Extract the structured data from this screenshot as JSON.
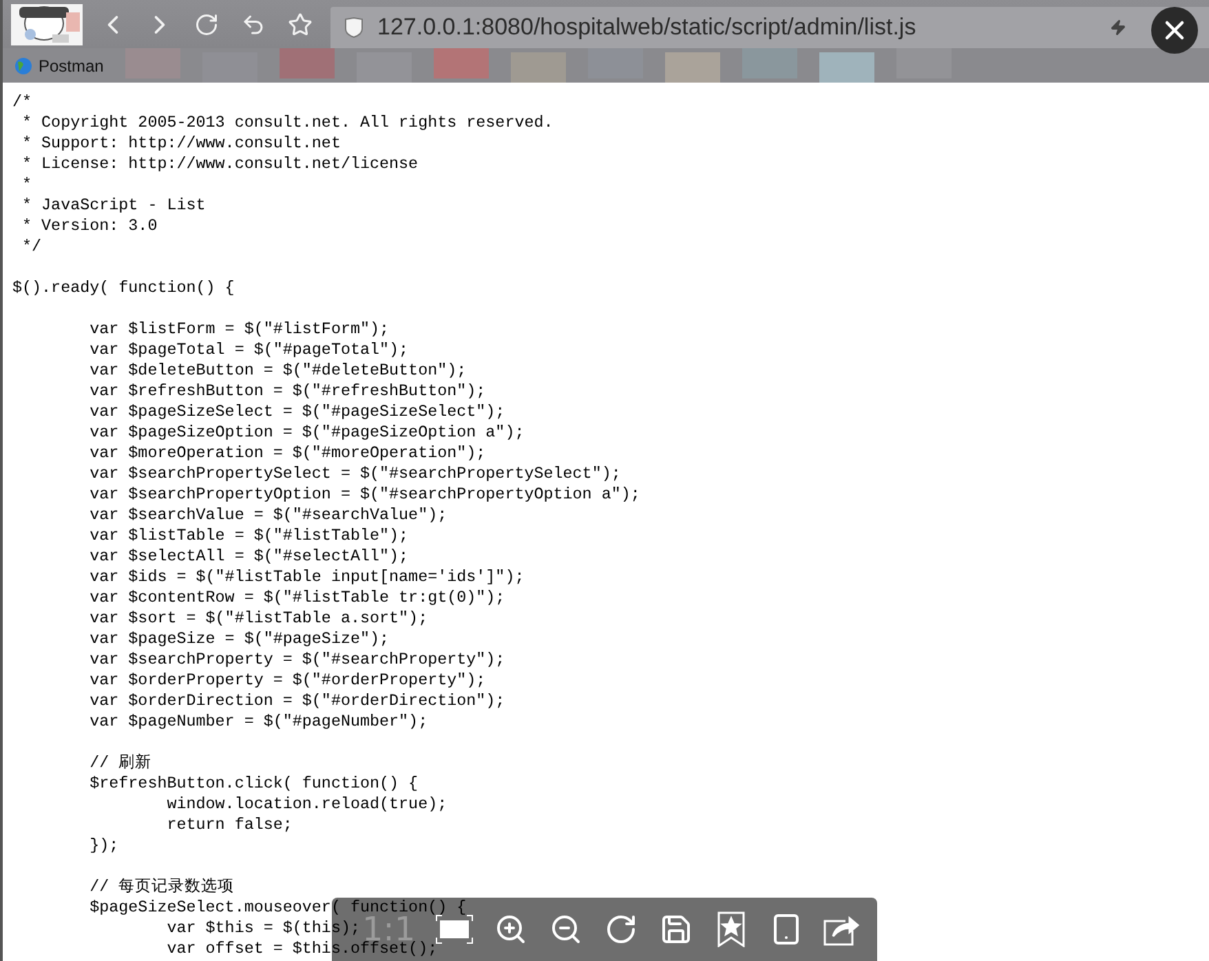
{
  "browser": {
    "url": "127.0.0.1:8080/hospitalweb/static/script/admin/list.js",
    "bookmarks": [
      {
        "label": "Postman"
      }
    ]
  },
  "code_blocks": [
    {
      "lines": [
        "/*",
        " * Copyright 2005-2013 consult.net. All rights reserved.",
        " * Support: http://www.consult.net",
        " * License: http://www.consult.net/license",
        " *",
        " * JavaScript - List",
        " * Version: 3.0",
        " */"
      ]
    },
    {
      "lines": [
        "$().ready( function() {"
      ]
    },
    {
      "lines": [
        "\tvar $listForm = $(\"#listForm\");",
        "\tvar $pageTotal = $(\"#pageTotal\");",
        "\tvar $deleteButton = $(\"#deleteButton\");",
        "\tvar $refreshButton = $(\"#refreshButton\");",
        "\tvar $pageSizeSelect = $(\"#pageSizeSelect\");",
        "\tvar $pageSizeOption = $(\"#pageSizeOption a\");",
        "\tvar $moreOperation = $(\"#moreOperation\");",
        "\tvar $searchPropertySelect = $(\"#searchPropertySelect\");",
        "\tvar $searchPropertyOption = $(\"#searchPropertyOption a\");",
        "\tvar $searchValue = $(\"#searchValue\");",
        "\tvar $listTable = $(\"#listTable\");",
        "\tvar $selectAll = $(\"#selectAll\");",
        "\tvar $ids = $(\"#listTable input[name='ids']\");",
        "\tvar $contentRow = $(\"#listTable tr:gt(0)\");",
        "\tvar $sort = $(\"#listTable a.sort\");",
        "\tvar $pageSize = $(\"#pageSize\");",
        "\tvar $searchProperty = $(\"#searchProperty\");",
        "\tvar $orderProperty = $(\"#orderProperty\");",
        "\tvar $orderDirection = $(\"#orderDirection\");",
        "\tvar $pageNumber = $(\"#pageNumber\");"
      ]
    },
    {
      "lines": [
        "\t// 刷新",
        "\t$refreshButton.click( function() {",
        "\t\twindow.location.reload(true);",
        "\t\treturn false;",
        "\t});"
      ]
    },
    {
      "lines": [
        "\t// 每页记录数选项",
        "\t$pageSizeSelect.mouseover( function() {",
        "\t\tvar $this = $(this);",
        "\t\tvar offset = $this.offset();"
      ]
    }
  ],
  "viewer_toolbar": {
    "zoom_label": "1:1"
  }
}
